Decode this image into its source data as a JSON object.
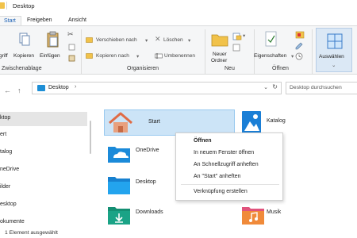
{
  "window": {
    "title": "Desktop"
  },
  "tabs": [
    "Start",
    "Freigeben",
    "Ansicht"
  ],
  "ribbon": {
    "clipboard": {
      "label": "Zwischenablage",
      "pin": "griff",
      "copy": "Kopieren",
      "paste": "Einfügen"
    },
    "organize": {
      "label": "Organisieren",
      "move_to": "Verschieben nach",
      "copy_to": "Kopieren nach",
      "delete": "Löschen",
      "rename": "Umbenennen"
    },
    "new": {
      "label": "Neu",
      "new_folder_line1": "Neuer",
      "new_folder_line2": "Ordner"
    },
    "open": {
      "label": "Öffnen",
      "properties": "Eigenschaften"
    },
    "select": {
      "label": "Auswählen"
    }
  },
  "address": {
    "path": "Desktop",
    "chevron": "›",
    "dropdown": "⌄",
    "refresh": "↻"
  },
  "search": {
    "placeholder": "Desktop durchsuchen"
  },
  "nav": {
    "back": "←",
    "up": "↑"
  },
  "sidebar": {
    "items": [
      {
        "label": "ktop",
        "selected": true
      },
      {
        "label": "ert"
      },
      {
        "label": "talog"
      },
      {
        "label": "neDrive"
      },
      {
        "label": "ilder"
      },
      {
        "label": "esktop"
      },
      {
        "label": "okumente"
      }
    ]
  },
  "files": [
    {
      "name": "Start",
      "icon": "home-icon",
      "selected": true
    },
    {
      "name": "Katalog",
      "icon": "image-icon"
    },
    {
      "name": "OneDrive",
      "icon": "onedrive-folder-icon"
    },
    {
      "name": "Desktop",
      "icon": "desktop-folder-icon"
    },
    {
      "name": "Downloads",
      "icon": "downloads-icon"
    },
    {
      "name": "Musik",
      "icon": "music-icon"
    }
  ],
  "context_menu": {
    "items": [
      "Öffnen",
      "In neuem Fenster öffnen",
      "An Schnellzugriff anheften",
      "An \"Start\" anheften",
      "Verknüpfung erstellen"
    ]
  },
  "status": {
    "text": "1 Element ausgewählt"
  },
  "colors": {
    "accent": "#1a5fb4",
    "folder": "#f1c24a",
    "selection": "#cce4f7"
  }
}
